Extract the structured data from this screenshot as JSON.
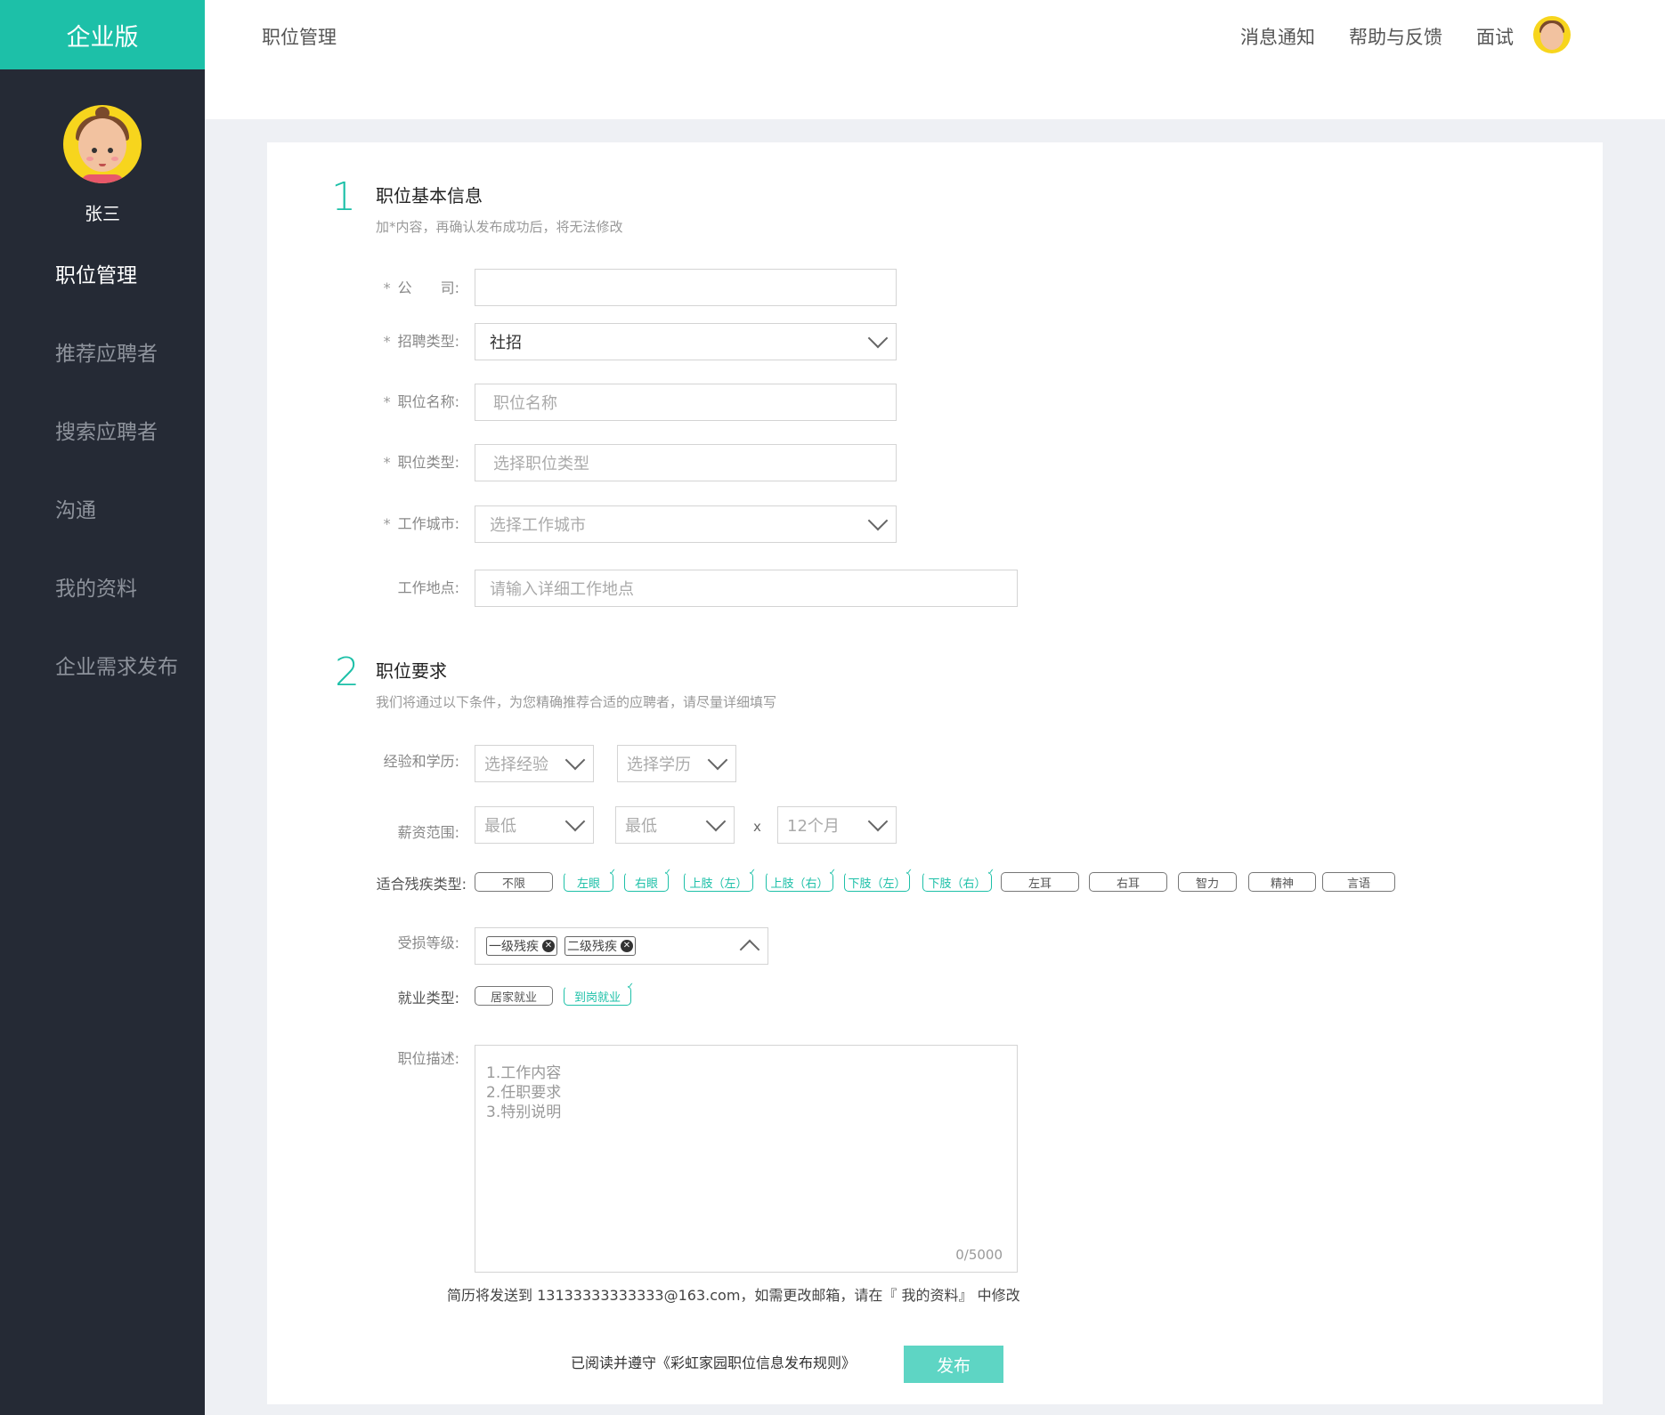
{
  "sidebar": {
    "brand": "企业版",
    "username": "张三",
    "items": [
      {
        "label": "职位管理"
      },
      {
        "label": "推荐应聘者"
      },
      {
        "label": "搜索应聘者"
      },
      {
        "label": "沟通"
      },
      {
        "label": "我的资料"
      },
      {
        "label": "企业需求发布"
      }
    ],
    "active_index": 0
  },
  "header": {
    "breadcrumb": "职位管理",
    "links": [
      "消息通知",
      "帮助与反馈",
      "面试"
    ]
  },
  "section1": {
    "number": "1",
    "title": "职位基本信息",
    "subtitle": "加*内容，再确认发布成功后，将无法修改",
    "fields": {
      "company": {
        "label": "公　　司:",
        "value": ""
      },
      "recruit_type": {
        "label": "招聘类型:",
        "value": "社招"
      },
      "job_name": {
        "label": "职位名称:",
        "placeholder": "职位名称"
      },
      "job_type": {
        "label": "职位类型:",
        "placeholder": "选择职位类型"
      },
      "city": {
        "label": "工作城市:",
        "placeholder": "选择工作城市"
      },
      "address": {
        "label": "工作地点:",
        "placeholder": "请输入详细工作地点"
      }
    }
  },
  "section2": {
    "number": "2",
    "title": "职位要求",
    "subtitle": "我们将通过以下条件，为您精确推荐合适的应聘者，请尽量详细填写",
    "exp_edu": {
      "label": "经验和学历:",
      "experience": "选择经验",
      "education": "选择学历"
    },
    "salary": {
      "label": "薪资范围:",
      "min": "最低",
      "max": "最低",
      "x": "x",
      "months": "12个月"
    },
    "disability": {
      "label": "适合残疾类型:",
      "tags": [
        {
          "text": "不限",
          "selected": false
        },
        {
          "text": "左眼",
          "selected": true
        },
        {
          "text": "右眼",
          "selected": true
        },
        {
          "text": "上肢（左）",
          "selected": true
        },
        {
          "text": "上肢（右）",
          "selected": true
        },
        {
          "text": "下肢（左）",
          "selected": true
        },
        {
          "text": "下肢（右）",
          "selected": true
        },
        {
          "text": "左耳",
          "selected": false
        },
        {
          "text": "右耳",
          "selected": false
        },
        {
          "text": "智力",
          "selected": false
        },
        {
          "text": "精神",
          "selected": false
        },
        {
          "text": "言语",
          "selected": false
        }
      ]
    },
    "level": {
      "label": "受损等级:",
      "chips": [
        "一级残疾",
        "二级残疾"
      ]
    },
    "employment": {
      "label": "就业类型:",
      "tags": [
        {
          "text": "居家就业",
          "selected": false
        },
        {
          "text": "到岗就业",
          "selected": true
        }
      ]
    },
    "description": {
      "label": "职位描述:",
      "placeholder_lines": [
        "1.工作内容",
        "2.任职要求",
        "3.特别说明"
      ],
      "counter": "0/5000"
    }
  },
  "notice": "简历将发送到 13133333333333@163.com，如需更改邮箱，请在『 我的资料』 中修改",
  "agreement": "已阅读并遵守《彩虹家园职位信息发布规则》",
  "publish_label": "发布",
  "colors": {
    "accent": "#1dc0a8",
    "sidebar_bg": "#252a35",
    "publish_bg": "#5ed5c4"
  }
}
